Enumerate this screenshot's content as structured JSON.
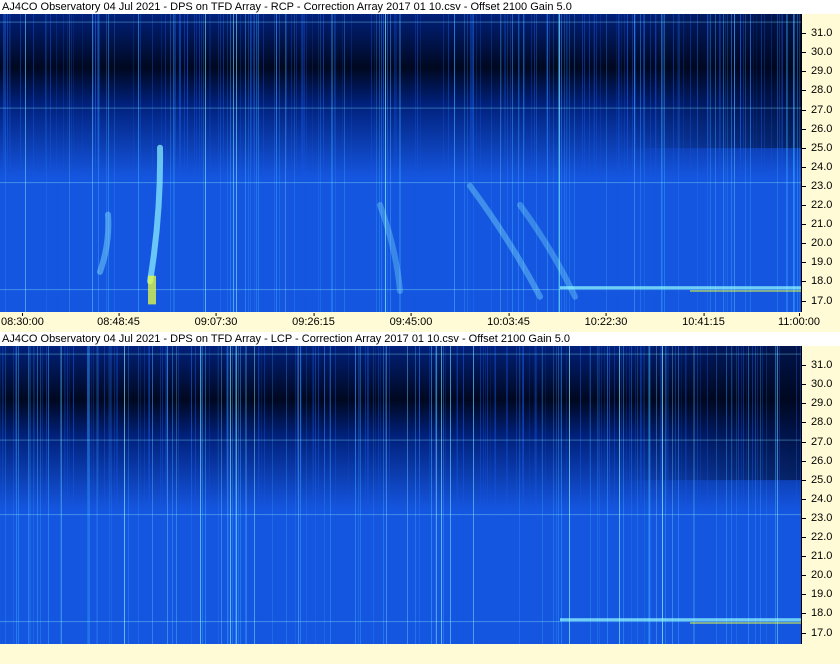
{
  "chart_data": [
    {
      "type": "heatmap",
      "title": "AJ4CO Observatory 04 Jul 2021  -  DPS on TFD Array  -  RCP  -  Correction Array 2017 01 10.csv  -  Offset 2100  Gain 5.0",
      "polarization": "RCP",
      "x_ticks": [
        "08:30:00",
        "08:48:45",
        "09:07:30",
        "09:26:15",
        "09:45:00",
        "10:03:45",
        "10:22:30",
        "10:41:15",
        "11:00:00"
      ],
      "y_ticks": [
        "31.0",
        "30.0",
        "29.0",
        "28.0",
        "27.0",
        "26.0",
        "25.0",
        "24.0",
        "23.0",
        "22.0",
        "21.0",
        "20.0",
        "19.0",
        "18.0",
        "17.0"
      ],
      "xlim": [
        "08:30:00",
        "11:00:00"
      ],
      "ylim": [
        16.4,
        32.0
      ],
      "colormap": [
        "#000820",
        "#00207a",
        "#1556e0",
        "#38a8ff",
        "#8ef7ff",
        "#e8ff40"
      ]
    },
    {
      "type": "heatmap",
      "title": "AJ4CO Observatory 04 Jul 2021  -  DPS on TFD Array  -  LCP  -  Correction Array 2017 01 10.csv  -  Offset 2100  Gain 5.0",
      "polarization": "LCP",
      "x_ticks": [],
      "y_ticks": [
        "31.0",
        "30.0",
        "29.0",
        "28.0",
        "27.0",
        "26.0",
        "25.0",
        "24.0",
        "23.0",
        "22.0",
        "21.0",
        "20.0",
        "19.0",
        "18.0",
        "17.0"
      ],
      "xlim": [
        "08:30:00",
        "11:00:00"
      ],
      "ylim": [
        16.4,
        32.0
      ],
      "colormap": [
        "#000820",
        "#00207a",
        "#1556e0",
        "#38a8ff",
        "#8ef7ff",
        "#e8ff40"
      ]
    }
  ]
}
